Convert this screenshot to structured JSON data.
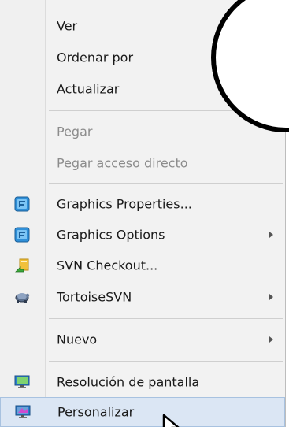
{
  "menu": {
    "ver": "Ver",
    "ordenar_por": "Ordenar por",
    "actualizar": "Actualizar",
    "pegar": "Pegar",
    "pegar_acceso_directo": "Pegar acceso directo",
    "graphics_properties": "Graphics Properties...",
    "graphics_options": "Graphics Options",
    "svn_checkout": "SVN Checkout...",
    "tortoisesvn": "TortoiseSVN",
    "nuevo": "Nuevo",
    "resolucion_de_pantalla": "Resolución de pantalla",
    "personalizar": "Personalizar"
  },
  "icons": {
    "graphics_properties": "graphics-icon",
    "graphics_options": "graphics-icon",
    "svn_checkout": "svn-checkout-icon",
    "tortoisesvn": "tortoise-icon",
    "resolucion_de_pantalla": "monitor-icon",
    "personalizar": "personalize-monitor-icon"
  },
  "colors": {
    "menu_bg": "#f2f2f2",
    "highlight_bg": "#dbe6f4",
    "highlight_border": "#a8c2e0",
    "disabled_text": "#8c8c8c"
  }
}
